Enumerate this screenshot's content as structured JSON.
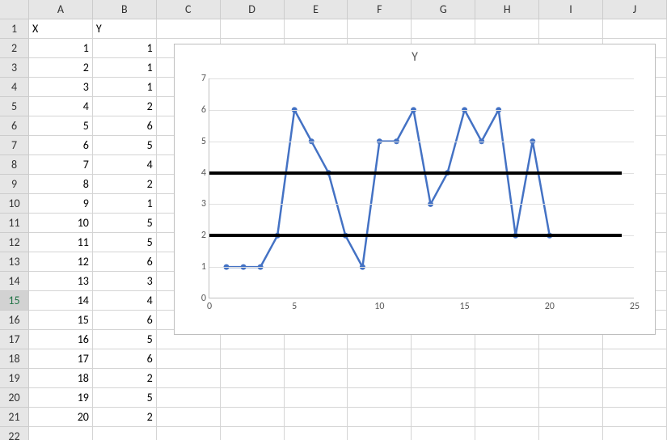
{
  "columns": [
    "A",
    "B",
    "C",
    "D",
    "E",
    "F",
    "G",
    "H",
    "I",
    "J"
  ],
  "headers": {
    "A": "X",
    "B": "Y"
  },
  "rows": [
    {
      "n": 1,
      "A": "X",
      "B": "Y"
    },
    {
      "n": 2,
      "A": "1",
      "B": "1"
    },
    {
      "n": 3,
      "A": "2",
      "B": "1"
    },
    {
      "n": 4,
      "A": "3",
      "B": "1"
    },
    {
      "n": 5,
      "A": "4",
      "B": "2"
    },
    {
      "n": 6,
      "A": "5",
      "B": "6"
    },
    {
      "n": 7,
      "A": "6",
      "B": "5"
    },
    {
      "n": 8,
      "A": "7",
      "B": "4"
    },
    {
      "n": 9,
      "A": "8",
      "B": "2"
    },
    {
      "n": 10,
      "A": "9",
      "B": "1"
    },
    {
      "n": 11,
      "A": "10",
      "B": "5"
    },
    {
      "n": 12,
      "A": "11",
      "B": "5"
    },
    {
      "n": 13,
      "A": "12",
      "B": "6"
    },
    {
      "n": 14,
      "A": "13",
      "B": "3"
    },
    {
      "n": 15,
      "A": "14",
      "B": "4"
    },
    {
      "n": 16,
      "A": "15",
      "B": "6"
    },
    {
      "n": 17,
      "A": "16",
      "B": "5"
    },
    {
      "n": 18,
      "A": "17",
      "B": "6"
    },
    {
      "n": 19,
      "A": "18",
      "B": "2"
    },
    {
      "n": 20,
      "A": "19",
      "B": "5"
    },
    {
      "n": 21,
      "A": "20",
      "B": "2"
    }
  ],
  "selected_row": 15,
  "chart_data": {
    "type": "line",
    "title": "Y",
    "xlabel": "",
    "ylabel": "",
    "xlim": [
      0,
      25
    ],
    "ylim": [
      0,
      7
    ],
    "xticks": [
      0,
      5,
      10,
      15,
      20,
      25
    ],
    "yticks": [
      0,
      1,
      2,
      3,
      4,
      5,
      6,
      7
    ],
    "grid_y": true,
    "series": [
      {
        "name": "Y",
        "color": "#4472c4",
        "x": [
          1,
          2,
          3,
          4,
          5,
          6,
          7,
          8,
          9,
          10,
          11,
          12,
          13,
          14,
          15,
          16,
          17,
          18,
          19,
          20
        ],
        "y": [
          1,
          1,
          1,
          2,
          6,
          5,
          4,
          2,
          1,
          5,
          5,
          6,
          3,
          4,
          6,
          5,
          6,
          2,
          5,
          2
        ]
      }
    ],
    "reference_lines": [
      {
        "y": 4,
        "color": "#000000"
      },
      {
        "y": 2,
        "color": "#000000"
      }
    ]
  }
}
